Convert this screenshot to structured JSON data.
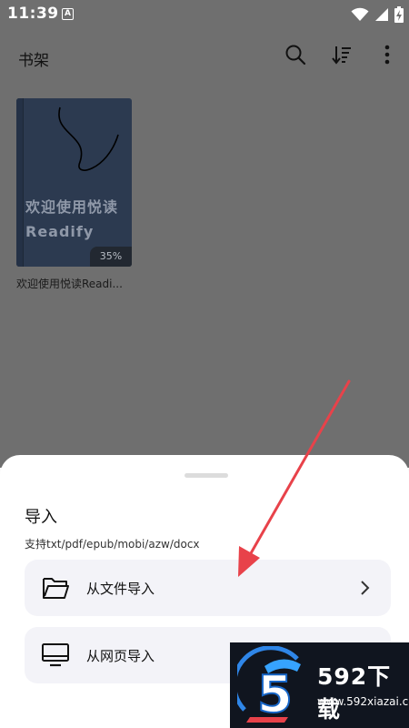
{
  "status_bar": {
    "time": "11:39",
    "notification_letter": "A"
  },
  "app_bar": {
    "title": "书架",
    "icons": [
      "search-icon",
      "sort-icon",
      "more-vertical-icon"
    ]
  },
  "books": [
    {
      "cover_text": "欢迎使用悦读Readify",
      "progress": "35%",
      "title": "欢迎使用悦读Readi..."
    }
  ],
  "sheet": {
    "title": "导入",
    "subtitle": "支持txt/pdf/epub/mobi/azw/docx",
    "options": [
      {
        "label": "从文件导入",
        "icon": "folder-icon"
      },
      {
        "label": "从网页导入",
        "icon": "monitor-icon"
      }
    ]
  },
  "watermark": {
    "logo_char": "5",
    "name": "592下载",
    "url": "www.592xiazai.com"
  },
  "colors": {
    "scrim": "#6f6f6f",
    "cover": "#2c3a50",
    "arrow": "#e8424a",
    "option_bg": "#f3f3f8"
  }
}
